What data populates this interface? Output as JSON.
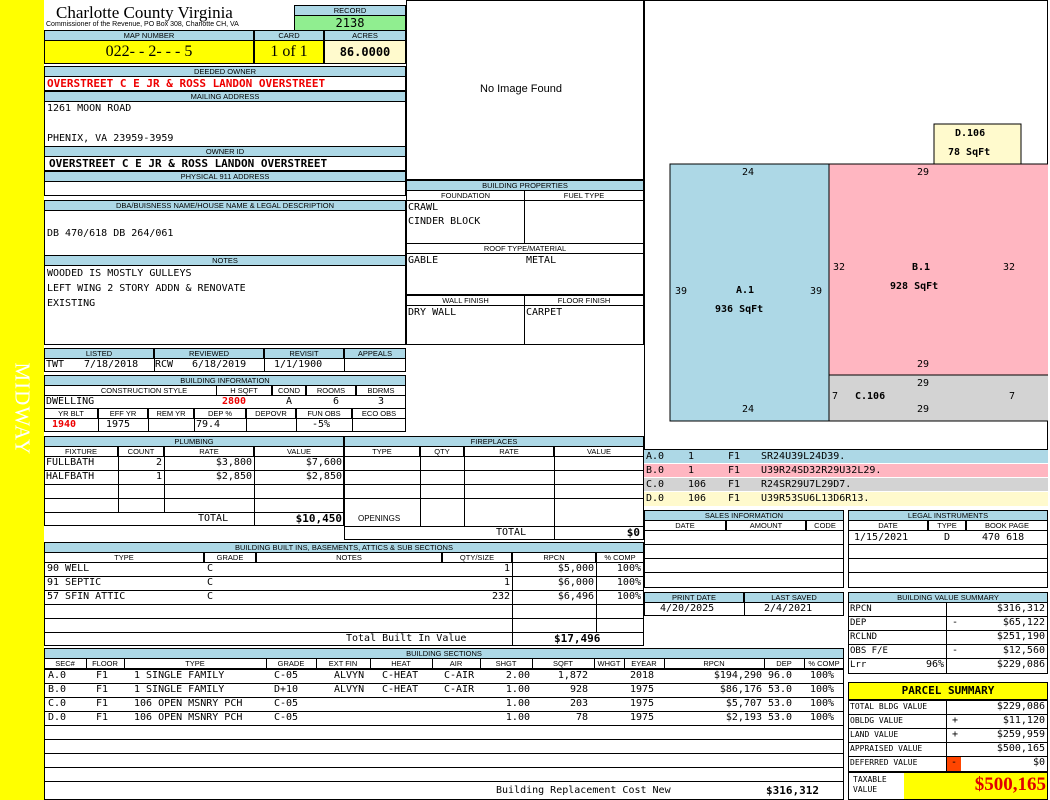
{
  "side_label": "MIDWAY",
  "header": {
    "county": "Charlotte County Virginia",
    "commissioner": "Commissioner of the Revenue, PO Box 308, Charlotte CH, VA",
    "record_label": "RECORD",
    "record": "2138",
    "map_label": "MAP NUMBER",
    "map_number": "022- - 2- - - 5",
    "card_label": "CARD",
    "card": "1 of 1",
    "acres_label": "ACRES",
    "acres": "86.0000"
  },
  "owner": {
    "deeded_label": "DEEDED OWNER",
    "deeded": "OVERSTREET C E JR & ROSS LANDON OVERSTREET",
    "mailing_label": "MAILING ADDRESS",
    "addr1": "1261 MOON ROAD",
    "addr2": "PHENIX, VA 23959-3959",
    "id_label": "OWNER ID",
    "owner_id": "OVERSTREET C E JR & ROSS LANDON OVERSTREET",
    "phys_label": "PHYSICAL 911 ADDRESS",
    "phys": ""
  },
  "dba": {
    "label": "DBA/BUISNESS NAME/HOUSE NAME & LEGAL DESCRIPTION",
    "text": "DB 470/618 DB 264/061"
  },
  "notes": {
    "label": "NOTES",
    "lines": [
      "WOODED IS MOSTLY GULLEYS",
      "LEFT WING 2 STORY ADDN & RENOVATE",
      "EXISTING"
    ]
  },
  "photo": {
    "text": "No Image Found"
  },
  "bp": {
    "label": "BUILDING PROPERTIES",
    "foundation_label": "FOUNDATION",
    "fuel_label": "FUEL TYPE",
    "foundation": [
      "CRAWL",
      "CINDER BLOCK"
    ],
    "roof_label": "ROOF TYPE/MATERIAL",
    "roof_type": "GABLE",
    "roof_mat": "METAL",
    "wall_label": "WALL FINISH",
    "floor_label": "FLOOR FINISH",
    "wall": "DRY WALL",
    "floor": "CARPET"
  },
  "review": {
    "listed_label": "LISTED",
    "reviewed_label": "REVIEWED",
    "revisit_label": "REVISIT",
    "appeals_label": "APPEALS",
    "listed_by": "TWT",
    "listed": "7/18/2018",
    "reviewed_by": "RCW",
    "reviewed": "6/18/2019",
    "revisit": "1/1/1900",
    "appeals": ""
  },
  "bi": {
    "label": "BUILDING INFORMATION",
    "cs_label": "CONSTRUCTION STYLE",
    "hsqft_label": "H SQFT",
    "cond_label": "COND",
    "rooms_label": "ROOMS",
    "bdrms_label": "BDRMS",
    "style": "DWELLING",
    "hsqft": "2800",
    "cond": "A",
    "rooms": "6",
    "bdrms": "3",
    "yrblt_label": "YR BLT",
    "effyr_label": "EFF YR",
    "remyr_label": "REM YR",
    "dep_label": "DEP %",
    "depovr_label": "DEPOVR",
    "funobs_label": "FUN OBS",
    "ecoobs_label": "ECO OBS",
    "yrblt": "1940",
    "effyr": "1975",
    "remyr": "",
    "dep": "79.4",
    "depovr": "",
    "funobs": "-5%",
    "ecoobs": ""
  },
  "plumbing": {
    "label": "PLUMBING",
    "cols": [
      "FIXTURE",
      "COUNT",
      "RATE",
      "VALUE"
    ],
    "rows": [
      [
        "FULLBATH",
        "2",
        "$3,800",
        "$7,600"
      ],
      [
        "HALFBATH",
        "1",
        "$2,850",
        "$2,850"
      ]
    ],
    "total_label": "TOTAL",
    "total": "$10,450"
  },
  "fireplaces": {
    "label": "FIREPLACES",
    "cols": [
      "TYPE",
      "QTY",
      "RATE",
      "VALUE"
    ],
    "openings_label": "OPENINGS",
    "total_label": "TOTAL",
    "total": "$0"
  },
  "builtins": {
    "label": "BUILDING BUILT INS, BASEMENTS, ATTICS & SUB SECTIONS",
    "cols": [
      "TYPE",
      "GRADE",
      "NOTES",
      "QTY/SIZE",
      "RPCN",
      "% COMP"
    ],
    "rows": [
      [
        "90 WELL",
        "C",
        "",
        "1",
        "$5,000",
        "100%"
      ],
      [
        "91 SEPTIC",
        "C",
        "",
        "1",
        "$6,000",
        "100%"
      ],
      [
        "57 SFIN ATTIC",
        "C",
        "",
        "232",
        "$6,496",
        "100%"
      ]
    ],
    "total_label": "Total Built In Value",
    "total": "$17,496"
  },
  "sections": {
    "label": "BUILDING SECTIONS",
    "cols": [
      "SEC#",
      "FLOOR",
      "TYPE",
      "GRADE",
      "EXT FIN",
      "HEAT",
      "AIR",
      "SHGT",
      "SQFT",
      "WHGT",
      "EYEAR",
      "RPCN",
      "DEP",
      "% COMP"
    ],
    "rows": [
      [
        "A.0",
        "F1",
        "1 SINGLE FAMILY",
        "C-05",
        "ALVYN",
        "C-HEAT",
        "C-AIR",
        "2.00",
        "1,872",
        "",
        "2018",
        "$194,290",
        "96.0",
        "100%"
      ],
      [
        "B.0",
        "F1",
        "1 SINGLE FAMILY",
        "D+10",
        "ALVYN",
        "C-HEAT",
        "C-AIR",
        "1.00",
        "928",
        "",
        "1975",
        "$86,176",
        "53.0",
        "100%"
      ],
      [
        "C.0",
        "F1",
        "106 OPEN MSNRY PCH",
        "C-05",
        "",
        "",
        "",
        "1.00",
        "203",
        "",
        "1975",
        "$5,707",
        "53.0",
        "100%"
      ],
      [
        "D.0",
        "F1",
        "106 OPEN MSNRY PCH",
        "C-05",
        "",
        "",
        "",
        "1.00",
        "78",
        "",
        "1975",
        "$2,193",
        "53.0",
        "100%"
      ]
    ],
    "total_label": "Building Replacement Cost New",
    "total": "$316,312"
  },
  "sketch": {
    "areas": [
      {
        "label": "A.1",
        "sqft": "936 SqFt",
        "color": "#add8e6"
      },
      {
        "label": "B.1",
        "sqft": "928 SqFt",
        "color": "#ffb6c1"
      },
      {
        "label": "C.106",
        "sqft": "",
        "color": "#d3d3d3"
      },
      {
        "label": "D.106",
        "sqft": "78 SqFt",
        "color": "#fffacd"
      }
    ],
    "dims": {
      "a_top": "24",
      "a_left": "39",
      "a_right": "39",
      "a_bot": "24",
      "b_top": "29",
      "b_left": "32",
      "b_right": "32",
      "b_bot": "29",
      "c_top": "29",
      "c_left": "7",
      "c_right": "7",
      "c_bot": "29"
    }
  },
  "legend": {
    "rows": [
      {
        "sec": "A.0",
        "code": "1",
        "floor": "F1",
        "path": "SR24U39L24D39.",
        "color": "#add8e6"
      },
      {
        "sec": "B.0",
        "code": "1",
        "floor": "F1",
        "path": "U39R24SD32R29U32L29.",
        "color": "#ffb6c1"
      },
      {
        "sec": "C.0",
        "code": "106",
        "floor": "F1",
        "path": "R24SR29U7L29D7.",
        "color": "#d3d3d3"
      },
      {
        "sec": "D.0",
        "code": "106",
        "floor": "F1",
        "path": "U39R53SU6L13D6R13.",
        "color": "#fffacd"
      }
    ]
  },
  "sales": {
    "label": "SALES INFORMATION",
    "cols": [
      "DATE",
      "AMOUNT",
      "CODE"
    ]
  },
  "legal": {
    "label": "LEGAL INSTRUMENTS",
    "cols": [
      "DATE",
      "TYPE",
      "BOOK PAGE"
    ],
    "rows": [
      [
        "1/15/2021",
        "D",
        "470 618"
      ]
    ]
  },
  "print": {
    "print_label": "PRINT DATE",
    "saved_label": "LAST SAVED",
    "print": "4/20/2025",
    "saved": "2/4/2021"
  },
  "bvs": {
    "label": "BUILDING VALUE SUMMARY",
    "rows": [
      [
        "RPCN",
        "",
        "",
        "$316,312"
      ],
      [
        "DEP",
        "",
        "-",
        "$65,122"
      ],
      [
        "RCLND",
        "",
        "",
        "$251,190"
      ],
      [
        "OBS F/E",
        "",
        "-",
        "$12,560"
      ],
      [
        "Lrr",
        "96%",
        "",
        "$229,086"
      ]
    ]
  },
  "parcel": {
    "label": "PARCEL SUMMARY",
    "rows": [
      [
        "TOTAL BLDG VALUE",
        "",
        "$229,086"
      ],
      [
        "OBLDG VALUE",
        "+",
        "$11,120"
      ],
      [
        "LAND VALUE",
        "+",
        "$259,959"
      ],
      [
        "APPRAISED VALUE",
        "",
        "$500,165"
      ],
      [
        "DEFERRED VALUE",
        "-",
        "$0"
      ]
    ],
    "taxable_label": "TAXABLE VALUE",
    "taxable": "$500,165"
  },
  "colors": {
    "header": "#add8e6",
    "yellow": "#ffff00",
    "record": "#90ee90",
    "deferred": "#ff4500",
    "value": "#e00000"
  }
}
